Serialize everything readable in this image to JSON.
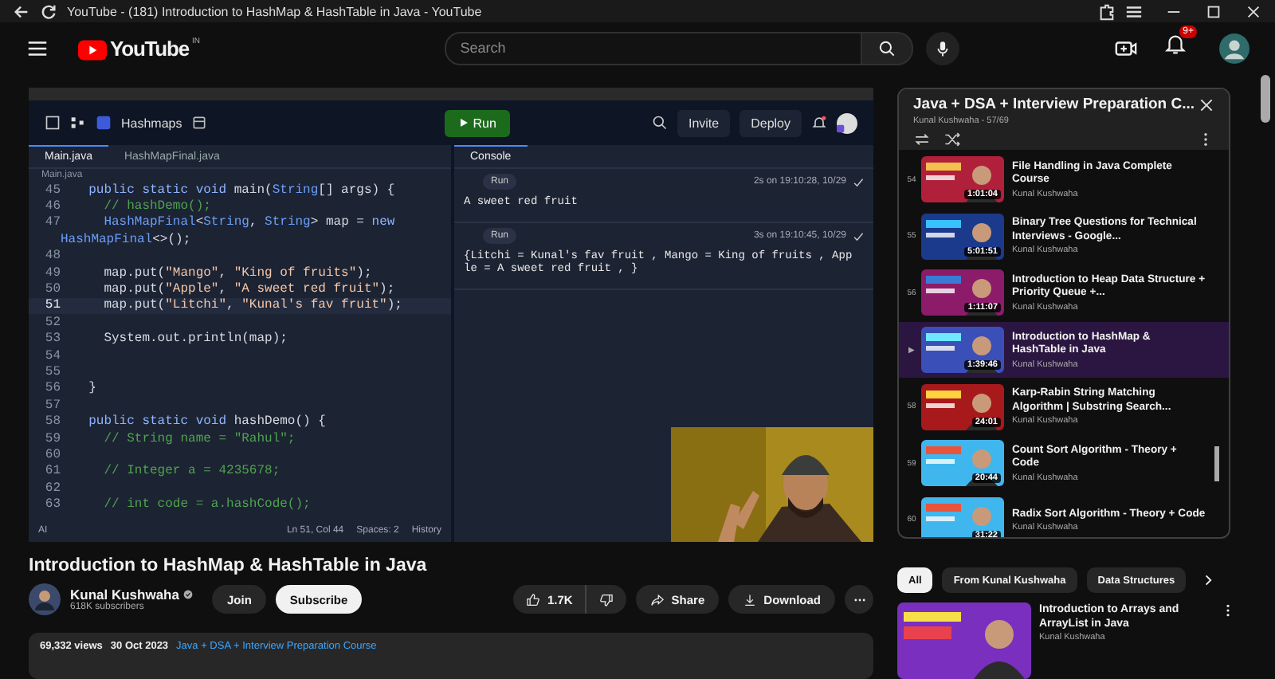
{
  "browser": {
    "title": "YouTube - (181) Introduction to HashMap & HashTable in Java - YouTube"
  },
  "header": {
    "logo": "YouTube",
    "region": "IN",
    "search": {
      "placeholder": "Search"
    },
    "notification_count": "9+"
  },
  "ide": {
    "project": "Hashmaps",
    "run": "Run",
    "invite": "Invite",
    "deploy": "Deploy",
    "tabs": [
      {
        "label": "Main.java",
        "selected": true
      },
      {
        "label": "HashMapFinal.java",
        "selected": false
      }
    ],
    "breadcrumb": "Main.java",
    "lines": [
      {
        "n": "45",
        "active": false,
        "parts": [
          {
            "kind": "keyword",
            "text": "  public static void "
          },
          {
            "kind": "plain",
            "text": "main("
          },
          {
            "kind": "type",
            "text": "String"
          },
          {
            "kind": "plain",
            "text": "[] args) {"
          }
        ]
      },
      {
        "n": "46",
        "active": false,
        "parts": [
          {
            "kind": "comment",
            "text": "    // hashDemo();"
          }
        ]
      },
      {
        "n": "47",
        "active": false,
        "parts": [
          {
            "kind": "type",
            "text": "    HashMapFinal"
          },
          {
            "kind": "plain",
            "text": "<"
          },
          {
            "kind": "type",
            "text": "String"
          },
          {
            "kind": "plain",
            "text": ", "
          },
          {
            "kind": "type",
            "text": "String"
          },
          {
            "kind": "plain",
            "text": "> map = "
          },
          {
            "kind": "keyword",
            "text": "new"
          }
        ],
        "wrap": [
          {
            "kind": "type",
            "text": "HashMapFinal"
          },
          {
            "kind": "plain",
            "text": "<>();"
          }
        ]
      },
      {
        "n": "48",
        "active": false
      },
      {
        "n": "49",
        "active": false,
        "parts": [
          {
            "kind": "plain",
            "text": "    map.put("
          },
          {
            "kind": "string",
            "text": "\"Mango\""
          },
          {
            "kind": "plain",
            "text": ", "
          },
          {
            "kind": "string",
            "text": "\"King of fruits\""
          },
          {
            "kind": "plain",
            "text": ");"
          }
        ]
      },
      {
        "n": "50",
        "active": false,
        "parts": [
          {
            "kind": "plain",
            "text": "    map.put("
          },
          {
            "kind": "string",
            "text": "\"Apple\""
          },
          {
            "kind": "plain",
            "text": ", "
          },
          {
            "kind": "string",
            "text": "\"A sweet red fruit\""
          },
          {
            "kind": "plain",
            "text": ");"
          }
        ]
      },
      {
        "n": "51",
        "active": true,
        "parts": [
          {
            "kind": "plain",
            "text": "    map.put("
          },
          {
            "kind": "string",
            "text": "\"Litchi\""
          },
          {
            "kind": "plain",
            "text": ", "
          },
          {
            "kind": "string",
            "text": "\"Kunal's fav fruit\""
          },
          {
            "kind": "plain",
            "text": ");"
          }
        ]
      },
      {
        "n": "52",
        "active": false
      },
      {
        "n": "53",
        "active": false,
        "parts": [
          {
            "kind": "plain",
            "text": "    System.out.println(map);"
          }
        ]
      },
      {
        "n": "54",
        "active": false
      },
      {
        "n": "55",
        "active": false
      },
      {
        "n": "56",
        "active": false,
        "parts": [
          {
            "kind": "plain",
            "text": "  }"
          }
        ]
      },
      {
        "n": "57",
        "active": false
      },
      {
        "n": "58",
        "active": false,
        "parts": [
          {
            "kind": "keyword",
            "text": "  public static void "
          },
          {
            "kind": "plain",
            "text": "hashDemo() {"
          }
        ]
      },
      {
        "n": "59",
        "active": false,
        "parts": [
          {
            "kind": "comment",
            "text": "    // String name = \"Rahul\";"
          }
        ]
      },
      {
        "n": "60",
        "active": false
      },
      {
        "n": "61",
        "active": false,
        "parts": [
          {
            "kind": "comment",
            "text": "    // Integer a = 4235678;"
          }
        ]
      },
      {
        "n": "62",
        "active": false
      },
      {
        "n": "63",
        "active": false,
        "parts": [
          {
            "kind": "comment",
            "text": "    // int code = a.hashCode();"
          }
        ]
      }
    ],
    "status": {
      "ai": "AI",
      "position": "Ln 51, Col 44",
      "spaces": "Spaces: 2",
      "history": "History"
    },
    "console": {
      "title": "Console",
      "runs": [
        {
          "label": "Run",
          "time": "2s on 19:10:28, 10/29",
          "output": [
            "A sweet red fruit"
          ]
        },
        {
          "label": "Run",
          "time": "3s on 19:10:45, 10/29",
          "output": [
            "{Litchi = Kunal's fav fruit , Mango = King of fruits , App",
            "le = A sweet red fruit , }"
          ]
        }
      ]
    }
  },
  "playlist": {
    "title": "Java + DSA + Interview Preparation C...",
    "subtitle": "Kunal Kushwaha - 57/69",
    "items": [
      {
        "marker": "54",
        "title": "File Handling in Java Complete Course",
        "channel": "Kunal Kushwaha",
        "duration": "1:01:04",
        "selected": false
      },
      {
        "marker": "55",
        "title": "Binary Tree Questions for Technical Interviews - Google...",
        "channel": "Kunal Kushwaha",
        "duration": "5:01:51",
        "selected": false
      },
      {
        "marker": "56",
        "title": "Introduction to Heap Data Structure + Priority Queue +...",
        "channel": "Kunal Kushwaha",
        "duration": "1:11:07",
        "selected": false
      },
      {
        "marker": "▶",
        "title": "Introduction to HashMap & HashTable in Java",
        "channel": "Kunal Kushwaha",
        "duration": "1:39:46",
        "selected": true
      },
      {
        "marker": "58",
        "title": "Karp-Rabin String Matching Algorithm | Substring Search...",
        "channel": "Kunal Kushwaha",
        "duration": "24:01",
        "selected": false
      },
      {
        "marker": "59",
        "title": "Count Sort Algorithm - Theory + Code",
        "channel": "Kunal Kushwaha",
        "duration": "20:44",
        "selected": false
      },
      {
        "marker": "60",
        "title": "Radix Sort Algorithm - Theory + Code",
        "channel": "Kunal Kushwaha",
        "duration": "31:22",
        "selected": false
      }
    ]
  },
  "video": {
    "title": "Introduction to HashMap & HashTable in Java",
    "channel": "Kunal Kushwaha",
    "subscribers": "618K subscribers",
    "join": "Join",
    "subscribe": "Subscribe",
    "likes": "1.7K",
    "share": "Share",
    "download": "Download",
    "views": "69,332 views",
    "date": "30 Oct 2023",
    "playlist_link": "Java + DSA + Interview Preparation Course"
  },
  "chips": [
    {
      "label": "All",
      "selected": true
    },
    {
      "label": "From Kunal Kushwaha",
      "selected": false
    },
    {
      "label": "Data Structures",
      "selected": false
    }
  ],
  "recommendations": [
    {
      "title": "Introduction to Arrays and ArrayList in Java",
      "channel": "Kunal Kushwaha"
    }
  ]
}
